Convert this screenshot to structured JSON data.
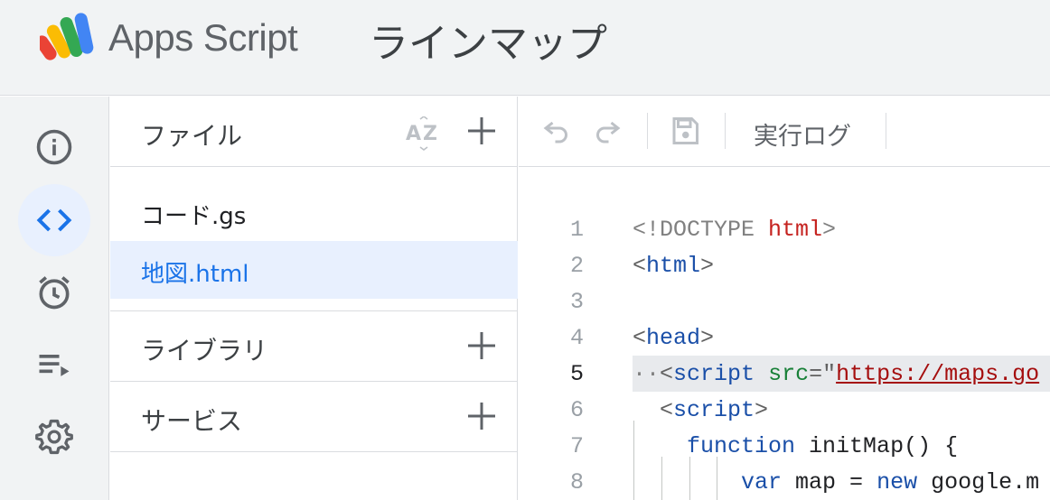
{
  "header": {
    "brand": "Apps Script",
    "project_title": "ラインマップ"
  },
  "rail": {
    "items": [
      "info-icon",
      "code-icon",
      "alarm-icon",
      "executions-icon",
      "gear-icon"
    ],
    "active": "code-icon"
  },
  "files_panel": {
    "title": "ファイル",
    "files": [
      {
        "name": "コード.gs",
        "selected": false
      },
      {
        "name": "地図.html",
        "selected": true
      }
    ],
    "libraries_label": "ライブラリ",
    "services_label": "サービス"
  },
  "toolbar": {
    "execution_log_label": "実行ログ"
  },
  "editor": {
    "current_line": 5,
    "lines": [
      {
        "n": "1",
        "tokens": [
          {
            "t": "<!DOCTYPE ",
            "c": "c-doc"
          },
          {
            "t": "html",
            "c": "c-red"
          },
          {
            "t": ">",
            "c": "c-doc"
          }
        ]
      },
      {
        "n": "2",
        "tokens": [
          {
            "t": "<",
            "c": "c-punc"
          },
          {
            "t": "html",
            "c": "c-tag"
          },
          {
            "t": ">",
            "c": "c-punc"
          }
        ]
      },
      {
        "n": "3",
        "tokens": []
      },
      {
        "n": "4",
        "tokens": [
          {
            "t": "<",
            "c": "c-punc"
          },
          {
            "t": "head",
            "c": "c-tag"
          },
          {
            "t": ">",
            "c": "c-punc"
          }
        ]
      },
      {
        "n": "5",
        "tokens": [
          {
            "t": "··",
            "c": "c-doc"
          },
          {
            "t": "<",
            "c": "c-punc"
          },
          {
            "t": "script",
            "c": "c-tag"
          },
          {
            "t": " ",
            "c": "c-plain"
          },
          {
            "t": "src",
            "c": "c-attr"
          },
          {
            "t": "=\"",
            "c": "c-punc"
          },
          {
            "t": "https://maps.go",
            "c": "c-str"
          }
        ]
      },
      {
        "n": "6",
        "tokens": [
          {
            "t": "  ",
            "c": "c-plain"
          },
          {
            "t": "<",
            "c": "c-punc"
          },
          {
            "t": "script",
            "c": "c-tag"
          },
          {
            "t": ">",
            "c": "c-punc"
          }
        ]
      },
      {
        "n": "7",
        "tokens": [
          {
            "t": "    ",
            "c": "c-plain"
          },
          {
            "t": "function",
            "c": "c-kw"
          },
          {
            "t": " initMap() {",
            "c": "c-plain"
          }
        ]
      },
      {
        "n": "8",
        "tokens": [
          {
            "t": "        ",
            "c": "c-plain"
          },
          {
            "t": "var",
            "c": "c-kw"
          },
          {
            "t": " map = ",
            "c": "c-plain"
          },
          {
            "t": "new",
            "c": "c-kw"
          },
          {
            "t": " google.m",
            "c": "c-plain"
          }
        ]
      }
    ]
  }
}
